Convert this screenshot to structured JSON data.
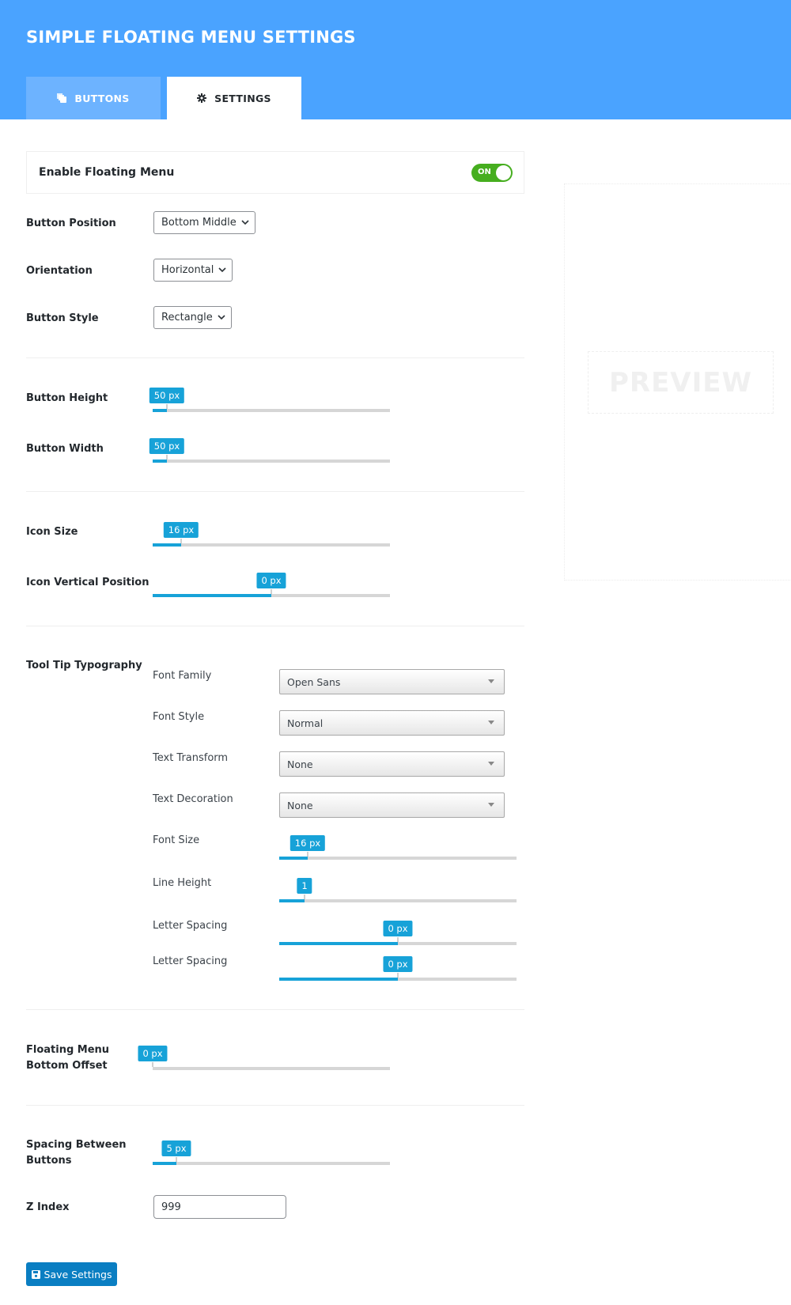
{
  "header": {
    "title": "SIMPLE FLOATING MENU SETTINGS",
    "background_color": "#4aa3ff",
    "tabs": [
      {
        "label": "BUTTONS",
        "icon": "copy-icon",
        "active": false
      },
      {
        "label": "SETTINGS",
        "icon": "gear-icon",
        "active": true
      }
    ]
  },
  "enable": {
    "label": "Enable Floating Menu",
    "toggle_state": "ON",
    "toggle_color": "#46ae1f"
  },
  "general": {
    "button_position": {
      "label": "Button Position",
      "value": "Bottom Middle"
    },
    "orientation": {
      "label": "Orientation",
      "value": "Horizontal"
    },
    "button_style": {
      "label": "Button Style",
      "value": "Rectangle"
    }
  },
  "sizes": {
    "button_height": {
      "label": "Button Height",
      "value_text": "50 px",
      "fill_fraction": 0.06
    },
    "button_width": {
      "label": "Button Width",
      "value_text": "50 px",
      "fill_fraction": 0.06
    }
  },
  "icon": {
    "icon_size": {
      "label": "Icon Size",
      "value_text": "16 px",
      "fill_fraction": 0.12
    },
    "icon_vertical_position": {
      "label": "Icon Vertical Position",
      "value_text": "0 px",
      "fill_fraction": 0.5
    }
  },
  "tooltip": {
    "label": "Tool Tip Typography",
    "font_family": {
      "label": "Font Family",
      "value": "Open Sans"
    },
    "font_style": {
      "label": "Font Style",
      "value": "Normal"
    },
    "text_transform": {
      "label": "Text Transform",
      "value": "None"
    },
    "text_decoration": {
      "label": "Text Decoration",
      "value": "None"
    },
    "font_size": {
      "label": "Font Size",
      "value_text": "16 px",
      "fill_fraction": 0.12
    },
    "line_height": {
      "label": "Line Height",
      "value_text": "1",
      "fill_fraction": 0.107
    },
    "letter_spacing_1": {
      "label": "Letter Spacing",
      "value_text": "0 px",
      "fill_fraction": 0.5
    },
    "letter_spacing_2": {
      "label": "Letter Spacing",
      "value_text": "0 px",
      "fill_fraction": 0.5
    }
  },
  "offset": {
    "label_line1": "Floating Menu",
    "label_line2": "Bottom Offset",
    "value_text": "0 px",
    "fill_fraction": 0
  },
  "spacing": {
    "label_line1": "Spacing Between",
    "label_line2": "Buttons",
    "value_text": "5 px",
    "fill_fraction": 0.1
  },
  "zindex": {
    "label": "Z Index",
    "value": "999"
  },
  "save": {
    "label": "Save Settings",
    "icon": "floppy-disk-icon"
  },
  "preview": {
    "label": "PREVIEW"
  },
  "colors": {
    "slider_accent": "#17a2d8",
    "save_button": "#0a7ec2"
  }
}
